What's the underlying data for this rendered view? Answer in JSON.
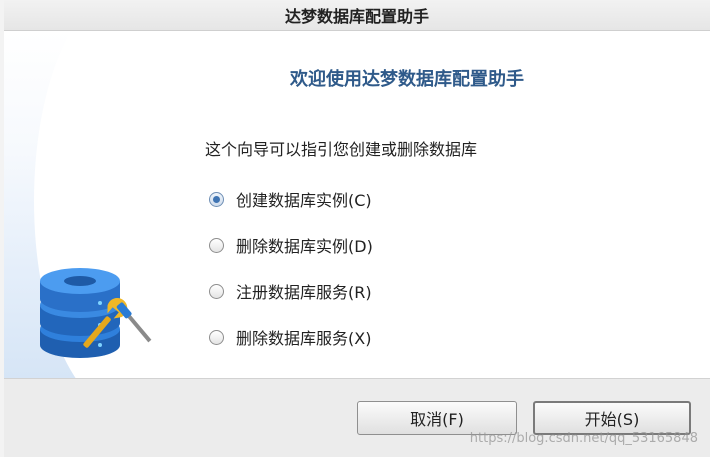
{
  "window": {
    "title": "达梦数据库配置助手"
  },
  "main": {
    "heading": "欢迎使用达梦数据库配置助手",
    "description": "这个向导可以指引您创建或删除数据库",
    "options": [
      {
        "label": "创建数据库实例(C)",
        "checked": true
      },
      {
        "label": "删除数据库实例(D)",
        "checked": false
      },
      {
        "label": "注册数据库服务(R)",
        "checked": false
      },
      {
        "label": "删除数据库服务(X)",
        "checked": false
      }
    ]
  },
  "buttons": {
    "cancel": "取消(F)",
    "start": "开始(S)"
  },
  "watermark": "https://blog.csdn.net/qq_53165848",
  "colors": {
    "heading": "#2f5a8a",
    "db_icon_blue": "#2b7ad6",
    "radio_selected": "#3f74b3"
  },
  "icons": {
    "logo": "database-wrench-icon"
  }
}
